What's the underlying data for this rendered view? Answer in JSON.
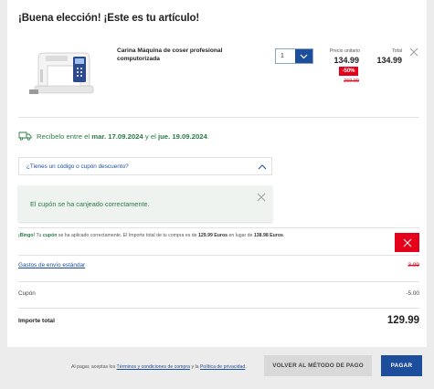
{
  "header": {
    "title": "¡Buena elección! ¡Este es tu artículo!"
  },
  "product": {
    "name": "Carina Máquina de coser profesional computorizada",
    "quantity": "1",
    "unit_label": "Precio unitario",
    "unit_price": "134.99",
    "discount_badge": "-50%",
    "old_price": "269.99",
    "total_label": "Total",
    "total_price": "134.99"
  },
  "delivery": {
    "prefix": "Recíbelo entre el",
    "date_from": "mar. 17.09.2024",
    "connector": "y el",
    "date_to": "jue. 19.09.2024",
    "suffix": "."
  },
  "coupon": {
    "toggle_label": "¿Tienes un código o cupón descuento?",
    "success_message": "El cupón se ha canjeado correctamente."
  },
  "bingo": {
    "lead": "¡Bingo!",
    "p1": "Tu",
    "cupon_word": "cupón",
    "p2": "se ha aplicado correctamente. El Importe total de tu compra es de",
    "new_total": "129.99 Euros",
    "p3": "en lugar de",
    "old_total": "138.98 Euros",
    "p4": "."
  },
  "summary": {
    "shipping_label": "Gastos de envío estándar",
    "shipping_value": "3.99",
    "coupon_label": "Cupón",
    "coupon_value": "-5.00",
    "total_label": "Importe total",
    "total_value": "129.99"
  },
  "footer": {
    "terms_prefix": "Al pagar, aceptas los",
    "terms_link": "Términos y condiciones de compra",
    "terms_mid": "y la",
    "privacy_link": "Política de privacidad",
    "terms_suffix": ".",
    "back_button": "VOLVER AL MÉTODO DE PAGO",
    "pay_button": "PAGAR"
  },
  "colors": {
    "accent_blue": "#1c4e9b",
    "success_green": "#2a7a45",
    "alert_red": "#e4001a"
  }
}
